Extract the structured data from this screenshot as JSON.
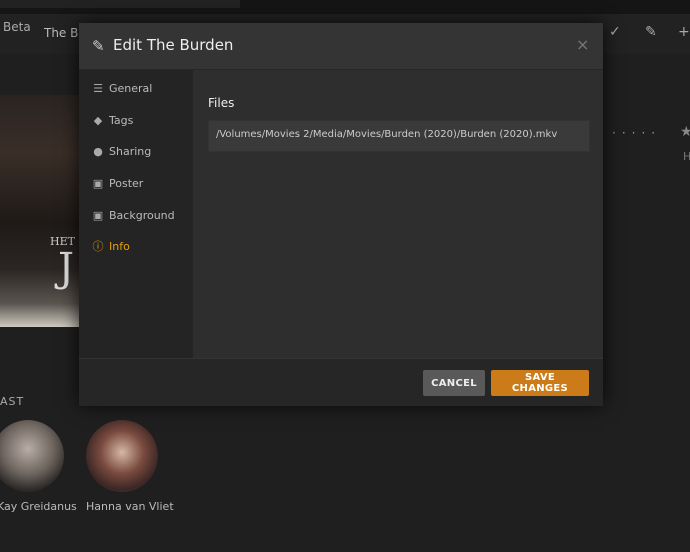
{
  "background": {
    "beta_label": "Beta",
    "title": "The Bu",
    "poster_text_small": "HET",
    "poster_text_big": "J",
    "cast_heading": "AST",
    "cast": [
      {
        "name": "Kay Greidanus"
      },
      {
        "name": "Hanna van Vliet"
      }
    ],
    "rating_label": "H"
  },
  "modal": {
    "title": "Edit The Burden",
    "close_symbol": "×",
    "nav": [
      {
        "label": "General",
        "icon": "list-icon"
      },
      {
        "label": "Tags",
        "icon": "tag-icon"
      },
      {
        "label": "Sharing",
        "icon": "users-icon"
      },
      {
        "label": "Poster",
        "icon": "image-icon"
      },
      {
        "label": "Background",
        "icon": "image-icon"
      },
      {
        "label": "Info",
        "icon": "info-icon",
        "active": true
      }
    ],
    "files_heading": "Files",
    "file_path": "/Volumes/Movies 2/Media/Movies/Burden (2020)/Burden (2020).mkv",
    "cancel_label": "CANCEL",
    "save_label": "SAVE CHANGES"
  },
  "colors": {
    "accent": "#e5a00d",
    "save_button": "#cc7b19"
  }
}
